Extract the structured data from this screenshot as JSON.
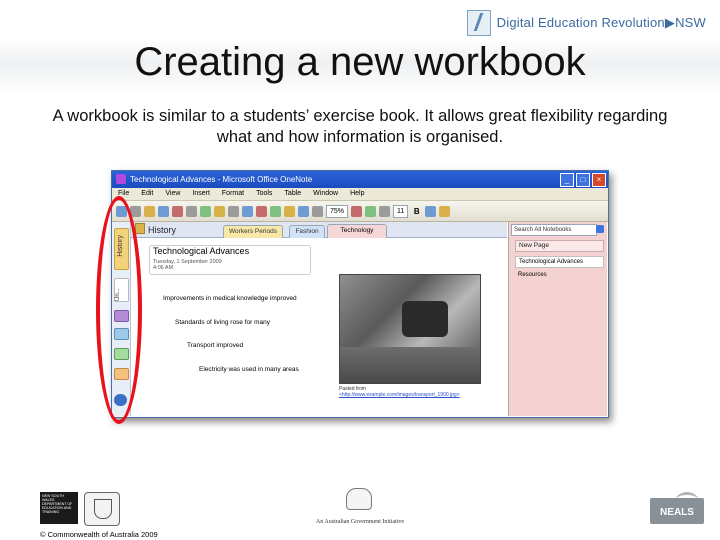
{
  "brand": {
    "name": "Digital Education Revolution▶NSW"
  },
  "slide": {
    "title": "Creating a new workbook",
    "subtitle": "A workbook is similar to a students’ exercise book. It allows great flexibility regarding what and how information is organised."
  },
  "window": {
    "title": "Technological Advances - Microsoft Office OneNote",
    "menu": [
      "File",
      "Edit",
      "View",
      "Insert",
      "Format",
      "Tools",
      "Table",
      "Window",
      "Help"
    ],
    "zoom": "75%",
    "font_size": "11",
    "bold_label": "B",
    "notebook_name": "History",
    "section_tabs": [
      "Workers Periods",
      "Fashion",
      "Technology"
    ],
    "nav_label": "History",
    "nav_label2": "Un...",
    "search_placeholder": "Search All Notebooks",
    "new_page": "New Page",
    "pages": [
      "Technological Advances",
      "Resources"
    ],
    "page": {
      "title": "Technological Advances",
      "date": "Tuesday, 1 September 2009",
      "time": "4:06 AM",
      "bullets": [
        "Improvements in medical knowledge improved",
        "Standards of living rose for many",
        "Transport improved",
        "Electricity was used in many areas"
      ],
      "pasted_from": "Pasted from",
      "pasted_link": "<http://www.example.com/images/transport_1900.jpg>"
    }
  },
  "footer": {
    "department": "NEW SOUTH WALES DEPARTMENT OF EDUCATION AND TRAINING",
    "copyright": "© Commonwealth of Australia 2009",
    "gov_initiative": "An Australian Government Initiative",
    "neals": "NEALS"
  },
  "colors": {
    "highlight_oval": "#e8121b",
    "title_bar": "#2a63d8",
    "page_pane": "#f4d2d2"
  }
}
